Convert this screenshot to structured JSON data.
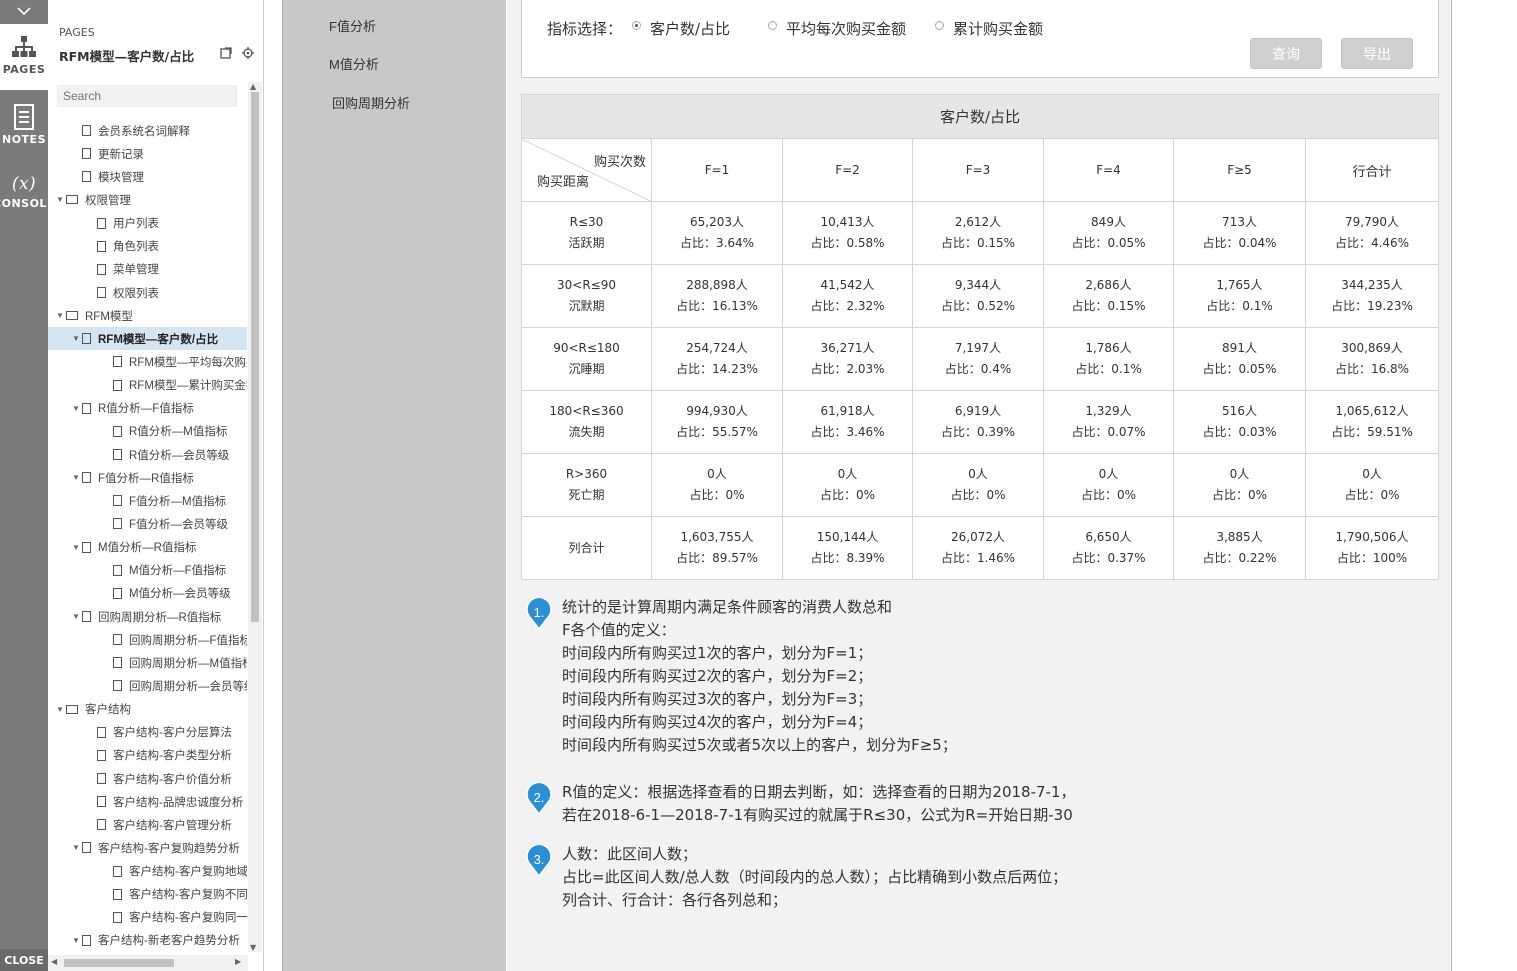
{
  "rail": {
    "pages_label": "PAGES",
    "notes_label": "NOTES",
    "console_label": "CONSOLE",
    "close_label": "CLOSE",
    "console_glyph": "(x)"
  },
  "pages_panel": {
    "section_label": "PAGES",
    "current_page": "RFM模型—客户数/占比",
    "search_placeholder": "Search",
    "tree": [
      {
        "label": "会员系统名词解释",
        "level": 1,
        "type": "page",
        "arrow": ""
      },
      {
        "label": "更新记录",
        "level": 1,
        "type": "page",
        "arrow": ""
      },
      {
        "label": "模块管理",
        "level": 1,
        "type": "page",
        "arrow": ""
      },
      {
        "label": "权限管理",
        "level": 0,
        "type": "folder",
        "arrow": "▼"
      },
      {
        "label": "用户列表",
        "level": 2,
        "type": "page",
        "arrow": ""
      },
      {
        "label": "角色列表",
        "level": 2,
        "type": "page",
        "arrow": ""
      },
      {
        "label": "菜单管理",
        "level": 2,
        "type": "page",
        "arrow": ""
      },
      {
        "label": "权限列表",
        "level": 2,
        "type": "page",
        "arrow": ""
      },
      {
        "label": "RFM模型",
        "level": 0,
        "type": "folder",
        "arrow": "▼"
      },
      {
        "label": "RFM模型—客户数/占比",
        "level": 1,
        "type": "page",
        "arrow": "▼",
        "selected": true
      },
      {
        "label": "RFM模型—平均每次购买",
        "level": 3,
        "type": "page",
        "arrow": ""
      },
      {
        "label": "RFM模型—累计购买金额",
        "level": 3,
        "type": "page",
        "arrow": ""
      },
      {
        "label": "R值分析—F值指标",
        "level": 1,
        "type": "page",
        "arrow": "▼"
      },
      {
        "label": "R值分析—M值指标",
        "level": 3,
        "type": "page",
        "arrow": ""
      },
      {
        "label": "R值分析—会员等级",
        "level": 3,
        "type": "page",
        "arrow": ""
      },
      {
        "label": "F值分析—R值指标",
        "level": 1,
        "type": "page",
        "arrow": "▼"
      },
      {
        "label": "F值分析—M值指标",
        "level": 3,
        "type": "page",
        "arrow": ""
      },
      {
        "label": "F值分析—会员等级",
        "level": 3,
        "type": "page",
        "arrow": ""
      },
      {
        "label": "M值分析—R值指标",
        "level": 1,
        "type": "page",
        "arrow": "▼"
      },
      {
        "label": "M值分析—F值指标",
        "level": 3,
        "type": "page",
        "arrow": ""
      },
      {
        "label": "M值分析—会员等级",
        "level": 3,
        "type": "page",
        "arrow": ""
      },
      {
        "label": "回购周期分析—R值指标",
        "level": 1,
        "type": "page",
        "arrow": "▼"
      },
      {
        "label": "回购周期分析—F值指标",
        "level": 3,
        "type": "page",
        "arrow": ""
      },
      {
        "label": "回购周期分析—M值指标",
        "level": 3,
        "type": "page",
        "arrow": ""
      },
      {
        "label": "回购周期分析—会员等级",
        "level": 3,
        "type": "page",
        "arrow": ""
      },
      {
        "label": "客户结构",
        "level": 0,
        "type": "folder",
        "arrow": "▼"
      },
      {
        "label": "客户结构-客户分层算法",
        "level": 2,
        "type": "page",
        "arrow": ""
      },
      {
        "label": "客户结构-客户类型分析",
        "level": 2,
        "type": "page",
        "arrow": ""
      },
      {
        "label": "客户结构-客户价值分析",
        "level": 2,
        "type": "page",
        "arrow": ""
      },
      {
        "label": "客户结构-品牌忠诚度分析",
        "level": 2,
        "type": "page",
        "arrow": ""
      },
      {
        "label": "客户结构-客户管理分析",
        "level": 2,
        "type": "page",
        "arrow": ""
      },
      {
        "label": "客户结构-客户复购趋势分析",
        "level": 1,
        "type": "page",
        "arrow": "▼"
      },
      {
        "label": "客户结构-客户复购地域",
        "level": 3,
        "type": "page",
        "arrow": ""
      },
      {
        "label": "客户结构-客户复购不同",
        "level": 3,
        "type": "page",
        "arrow": ""
      },
      {
        "label": "客户结构-客户复购同一",
        "level": 3,
        "type": "page",
        "arrow": ""
      },
      {
        "label": "客户结构-新老客户趋势分析",
        "level": 1,
        "type": "page",
        "arrow": "▼"
      }
    ]
  },
  "subnav": {
    "items": [
      "F值分析",
      "M值分析",
      "回购周期分析"
    ]
  },
  "filter": {
    "label": "指标选择：",
    "options": [
      "客户数/占比",
      "平均每次购买金额",
      "累计购买金额"
    ],
    "selected_index": 0,
    "query_button": "查询",
    "export_button": "导出"
  },
  "table": {
    "title": "客户数/占比",
    "corner_top": "购买次数",
    "corner_bottom": "购买距离",
    "columns": [
      "F=1",
      "F=2",
      "F=3",
      "F=4",
      "F≥5",
      "行合计"
    ],
    "rows": [
      {
        "r1": "R≤30",
        "r2": "活跃期",
        "cells": [
          [
            "65,203人",
            "占比：3.64%"
          ],
          [
            "10,413人",
            "占比：0.58%"
          ],
          [
            "2,612人",
            "占比：0.15%"
          ],
          [
            "849人",
            "占比：0.05%"
          ],
          [
            "713人",
            "占比：0.04%"
          ],
          [
            "79,790人",
            "占比：4.46%"
          ]
        ]
      },
      {
        "r1": "30<R≤90",
        "r2": "沉默期",
        "cells": [
          [
            "288,898人",
            "占比：16.13%"
          ],
          [
            "41,542人",
            "占比：2.32%"
          ],
          [
            "9,344人",
            "占比：0.52%"
          ],
          [
            "2,686人",
            "占比：0.15%"
          ],
          [
            "1,765人",
            "占比：0.1%"
          ],
          [
            "344,235人",
            "占比：19.23%"
          ]
        ]
      },
      {
        "r1": "90<R≤180",
        "r2": "沉睡期",
        "cells": [
          [
            "254,724人",
            "占比：14.23%"
          ],
          [
            "36,271人",
            "占比：2.03%"
          ],
          [
            "7,197人",
            "占比：0.4%"
          ],
          [
            "1,786人",
            "占比：0.1%"
          ],
          [
            "891人",
            "占比：0.05%"
          ],
          [
            "300,869人",
            "占比：16.8%"
          ]
        ]
      },
      {
        "r1": "180<R≤360",
        "r2": "流失期",
        "cells": [
          [
            "994,930人",
            "占比：55.57%"
          ],
          [
            "61,918人",
            "占比：3.46%"
          ],
          [
            "6,919人",
            "占比：0.39%"
          ],
          [
            "1,329人",
            "占比：0.07%"
          ],
          [
            "516人",
            "占比：0.03%"
          ],
          [
            "1,065,612人",
            "占比：59.51%"
          ]
        ]
      },
      {
        "r1": "R>360",
        "r2": "死亡期",
        "cells": [
          [
            "0人",
            "占比：0%"
          ],
          [
            "0人",
            "占比：0%"
          ],
          [
            "0人",
            "占比：0%"
          ],
          [
            "0人",
            "占比：0%"
          ],
          [
            "0人",
            "占比：0%"
          ],
          [
            "0人",
            "占比：0%"
          ]
        ]
      },
      {
        "r1": "列合计",
        "r2": "",
        "cells": [
          [
            "1,603,755人",
            "占比：89.57%"
          ],
          [
            "150,144人",
            "占比：8.39%"
          ],
          [
            "26,072人",
            "占比：1.46%"
          ],
          [
            "6,650人",
            "占比：0.37%"
          ],
          [
            "3,885人",
            "占比：0.22%"
          ],
          [
            "1,790,506人",
            "占比：100%"
          ]
        ]
      }
    ]
  },
  "notes": [
    {
      "num": "1.",
      "lines": [
        "统计的是计算周期内满足条件顾客的消费人数总和",
        "F各个值的定义：",
        "时间段内所有购买过1次的客户，划分为F=1；",
        "时间段内所有购买过2次的客户，划分为F=2；",
        "时间段内所有购买过3次的客户，划分为F=3；",
        "时间段内所有购买过4次的客户，划分为F=4；",
        "时间段内所有购买过5次或者5次以上的客户，划分为F≥5；"
      ]
    },
    {
      "num": "2.",
      "lines": [
        "R值的定义：根据选择查看的日期去判断，如：选择查看的日期为2018-7-1，",
        "若在2018-6-1—2018-7-1有购买过的就属于R≤30，公式为R=开始日期-30"
      ]
    },
    {
      "num": "3.",
      "lines": [
        "人数：此区间人数；",
        "占比=此区间人数/总人数（时间段内的总人数）；占比精确到小数点后两位；",
        "列合计、行合计：各行各列总和；"
      ]
    }
  ],
  "colors": {
    "pin": "#2c8fd6",
    "rail": "#7b7b7b",
    "subnav": "#c8c8c8",
    "selected_row": "#d5e6f2"
  }
}
